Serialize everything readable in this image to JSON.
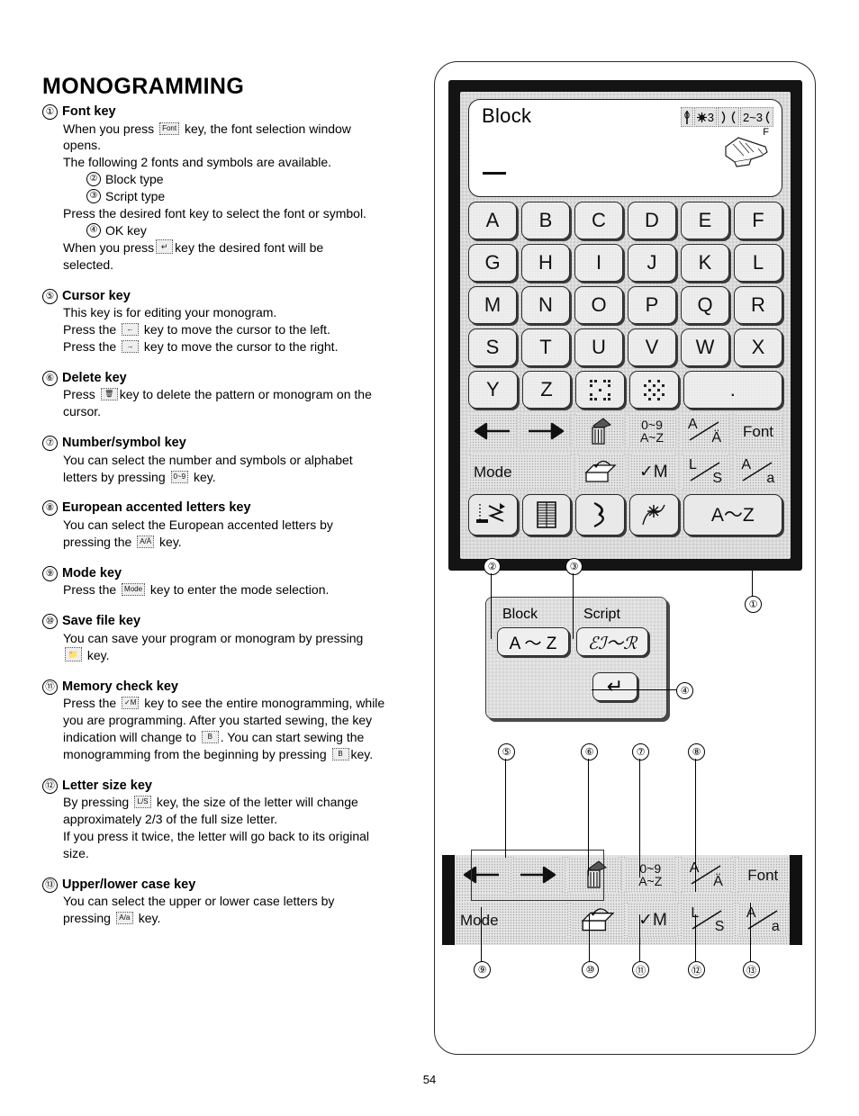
{
  "page": {
    "title": "MONOGRAMMING",
    "number": "54"
  },
  "entries": [
    {
      "num": "①",
      "heading": "Font key",
      "lines": [
        "When you press [Font] key, the font selection window",
        "opens.",
        "The following 2 fonts and symbols are available."
      ],
      "subitems": [
        {
          "num": "②",
          "label": "Block type"
        },
        {
          "num": "③",
          "label": "Script type"
        }
      ],
      "lines2": [
        "Press the desired font key to select the font or symbol."
      ],
      "subitems2": [
        {
          "num": "④",
          "label": "OK key"
        }
      ],
      "lines3": [
        "When you press [↵] key the desired font will be",
        "selected."
      ]
    },
    {
      "num": "⑤",
      "heading": "Cursor key",
      "lines": [
        "This key is for editing your monogram.",
        "Press the [←] key to move the cursor to the left.",
        "Press the [→] key to move the cursor to the right."
      ]
    },
    {
      "num": "⑥",
      "heading": "Delete key",
      "lines": [
        "Press [trash] key to delete the pattern or monogram on the",
        "cursor."
      ]
    },
    {
      "num": "⑦",
      "heading": "Number/symbol key",
      "lines": [
        "You can select the number and symbols or alphabet",
        "letters by pressing [0~9 A~Z] key."
      ]
    },
    {
      "num": "⑧",
      "heading": "European accented letters key",
      "lines": [
        "You can select the European accented letters by",
        "pressing the [A/Ä] key."
      ]
    },
    {
      "num": "⑨",
      "heading": "Mode key",
      "lines": [
        "Press the [Mode] key to enter the mode selection."
      ]
    },
    {
      "num": "⑩",
      "heading": "Save file key",
      "lines": [
        "You can save your program or monogram by pressing",
        "[save] key."
      ]
    },
    {
      "num": "⑪",
      "heading": "Memory check key",
      "lines": [
        "Press the [✓M] key to see the entire monogramming, while",
        "you are programming. After you started sewing, the key",
        "indication will change to [B]. You can start sewing the",
        "monogramming from the beginning by pressing [B] key."
      ]
    },
    {
      "num": "⑫",
      "heading": "Letter size key",
      "lines": [
        "By pressing [L/S] key, the size of the letter will change",
        "approximately 2/3 of the full size letter.",
        "If you press it twice, the letter will go back to its original",
        "size."
      ]
    },
    {
      "num": "⑬",
      "heading": "Upper/lower case key",
      "lines": [
        "You can select the upper or lower case letters by",
        "pressing [A/a] key."
      ]
    }
  ],
  "lcd": {
    "font_label": "Block",
    "status": {
      "needle_icon": "needle-icon",
      "tension_icon": "tension-icon",
      "tension_value": "3",
      "foot_width_open": ")(",
      "stitch_range": "2~3",
      "presser_foot_letter": "F",
      "presser_foot_icon": "presser-foot-icon"
    },
    "keyboard_rows": [
      [
        "A",
        "B",
        "C",
        "D",
        "E",
        "F"
      ],
      [
        "G",
        "H",
        "I",
        "J",
        "K",
        "L"
      ],
      [
        "M",
        "N",
        "O",
        "P",
        "Q",
        "R"
      ],
      [
        "S",
        "T",
        "U",
        "V",
        "W",
        "X"
      ],
      [
        "Y",
        "Z",
        "symbol-1",
        "symbol-2",
        "."
      ]
    ],
    "function_row_1": [
      {
        "name": "cursor-left",
        "label": "←"
      },
      {
        "name": "cursor-right",
        "label": "→"
      },
      {
        "name": "delete",
        "label": "trash-icon"
      },
      {
        "name": "number-symbol",
        "label_top": "0~9",
        "label_bottom": "A~Z"
      },
      {
        "name": "accented-letters",
        "label_top": "A",
        "label_bottom": "Ä"
      },
      {
        "name": "font",
        "label": "Font"
      }
    ],
    "function_row_2": [
      {
        "name": "mode",
        "label": "Mode"
      },
      {
        "name": "spacer",
        "label": ""
      },
      {
        "name": "save-file",
        "label": "save-file-icon"
      },
      {
        "name": "memory-check",
        "label": "✓M"
      },
      {
        "name": "letter-size",
        "label_top": "L",
        "label_bottom": "S"
      },
      {
        "name": "upper-lower-case",
        "label_top": "A",
        "label_bottom": "a"
      }
    ],
    "bottom_row": [
      {
        "name": "stitch-pattern-1",
        "label": "zigzag-icon"
      },
      {
        "name": "stitch-pattern-2",
        "label": "buttonhole-icon"
      },
      {
        "name": "stitch-pattern-3",
        "label": "satin-icon"
      },
      {
        "name": "stitch-pattern-4",
        "label": "decorative-icon"
      },
      {
        "name": "monogram",
        "label": "A～Z"
      }
    ]
  },
  "font_popup": {
    "block_label": "Block",
    "script_label": "Script",
    "block_key": "A ～ Z",
    "script_key": "ℰℐ～ℛ",
    "ok_key": "↵"
  },
  "callouts": {
    "c1": "①",
    "c2": "②",
    "c3": "③",
    "c4": "④",
    "c5": "⑤",
    "c6": "⑥",
    "c7": "⑦",
    "c8": "⑧",
    "c9": "⑨",
    "c10": "⑩",
    "c11": "⑪",
    "c12": "⑫",
    "c13": "⑬"
  }
}
